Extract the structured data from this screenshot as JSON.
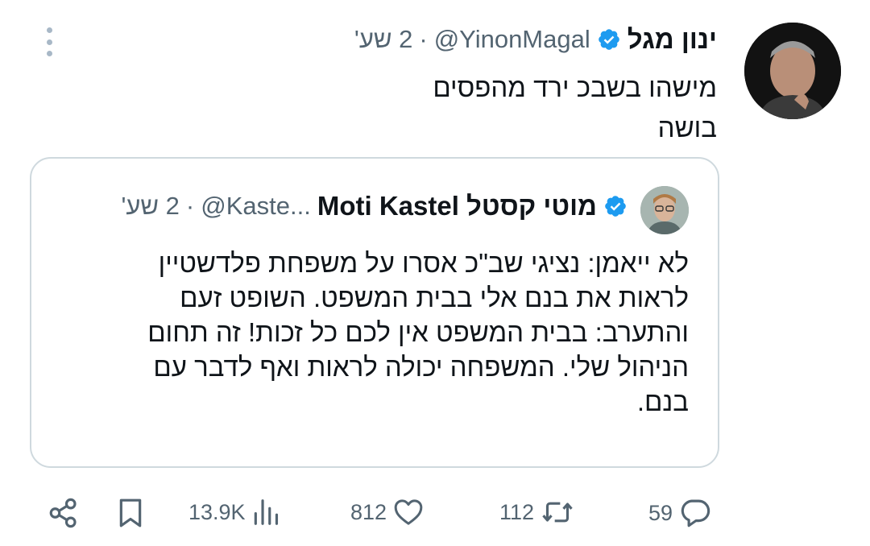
{
  "tweet": {
    "author_name": "ינון מגל",
    "handle": "@YinonMagal",
    "separator": "·",
    "time": "2 שע'",
    "text_lines": [
      "מישהו בשבכ ירד מהפסים",
      "בושה"
    ]
  },
  "quoted_tweet": {
    "author_name": "Moti Kastel מוטי קסטל",
    "handle": "@Kaste...",
    "separator": "·",
    "time": "2 שע'",
    "text_lines": [
      "לא ייאמן: נציגי שב\"כ אסרו על משפחת פלדשטיין",
      "לראות את בנם אלי בבית המשפט. השופט זעם",
      "והתערב: בבית המשפט אין לכם כל זכות! זה תחום",
      "הניהול שלי. המשפחה יכולה לראות ואף לדבר עם",
      "בנם."
    ]
  },
  "actions": {
    "views": "13.9K",
    "likes": "812",
    "reposts": "112",
    "replies": "59"
  },
  "colors": {
    "verified": "#1d9bf0",
    "muted": "#536471",
    "text": "#0f1419",
    "border": "#cfd9de"
  },
  "icons": [
    "more-vertical-icon",
    "verified-badge-icon",
    "share-icon",
    "bookmark-icon",
    "views-icon",
    "like-icon",
    "repost-icon",
    "reply-icon"
  ]
}
